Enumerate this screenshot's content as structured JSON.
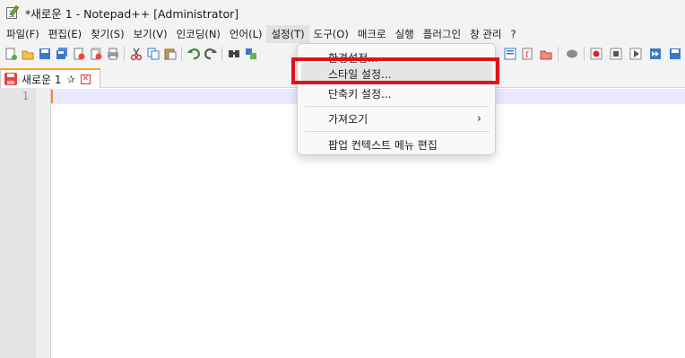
{
  "window": {
    "title": "*새로운 1 - Notepad++ [Administrator]"
  },
  "menubar": {
    "items": [
      "파일(F)",
      "편집(E)",
      "찾기(S)",
      "보기(V)",
      "인코딩(N)",
      "언어(L)",
      "설정(T)",
      "도구(O)",
      "매크로",
      "실행",
      "플러그인",
      "창 관리",
      "?"
    ],
    "active_item": "설정(T)"
  },
  "toolbar": {
    "icons": [
      "new-file-icon",
      "open-file-icon",
      "save-icon",
      "save-all-icon",
      "close-icon",
      "close-all-icon",
      "print-icon",
      "cut-icon",
      "copy-icon",
      "paste-icon",
      "undo-icon",
      "redo-icon",
      "find-icon",
      "replace-icon",
      "document-map-icon",
      "function-list-icon",
      "folder-workspace-icon",
      "monitoring-icon",
      "record-macro-icon",
      "stop-macro-icon",
      "play-macro-icon",
      "run-macro-multiple-icon",
      "save-macro-icon"
    ]
  },
  "tabs": [
    {
      "label": "새로운 1",
      "pin": "✰",
      "close": "✕"
    }
  ],
  "editor": {
    "line_numbers": [
      "1"
    ]
  },
  "settings_menu": {
    "items": [
      {
        "label": "환경설정..."
      },
      {
        "label": "스타일 설정..."
      },
      {
        "label": "단축키 설정..."
      },
      {
        "label": "가져오기",
        "submenu_arrow": "›"
      },
      {
        "label": "팝업 컨텍스트 메뉴 편집"
      }
    ],
    "highlighted_item": "스타일 설정..."
  },
  "colors": {
    "highlight_border": "#e0121a",
    "tab_accent": "#f5a623",
    "caret": "#f28c28",
    "current_line": "#e8e8ff"
  }
}
